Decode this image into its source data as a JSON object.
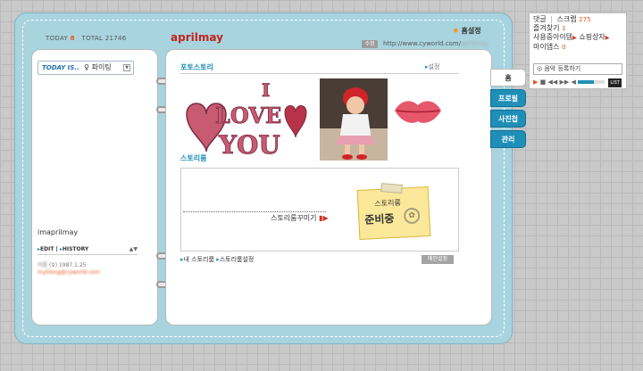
{
  "header": {
    "today_label": "TODAY",
    "today_value": "8",
    "total_label": "TOTAL",
    "total_value": "21746",
    "title": "aprilmay",
    "home_settings": "홈설정",
    "edit_button": "수정",
    "url_visible": "http://www.cyworld.com/",
    "url_hidden": "aprilmay"
  },
  "left_page": {
    "today_is_label": "TODAY IS..",
    "today_mood": "파이팅",
    "owner_name": "imaprilmay",
    "edit_label": "EDIT",
    "history_label": "HISTORY",
    "profile_line1_blurred": "이름",
    "profile_line1": "(♀) 1987.1.25",
    "profile_line2_blurred": "mylilong@cyworld.com"
  },
  "photo_section": {
    "title": "포토스토리",
    "settings": "설정",
    "love_text": [
      "I",
      "LOVE",
      "YOU"
    ]
  },
  "story_section": {
    "title": "스토리룸",
    "decorate_link": "스토리룸꾸미기",
    "note_line1": "스토리룸",
    "note_line2": "준비중",
    "my_storyroom": "내 스토리룸",
    "storyroom_settings": "스토리룸설정",
    "main_settings": "메인설정"
  },
  "tabs": [
    {
      "label": "홈"
    },
    {
      "label": "프로필"
    },
    {
      "label": "사진첩"
    },
    {
      "label": "관리"
    }
  ],
  "notify": {
    "comments": "댓글",
    "scrap": "스크랩",
    "scrap_count": "275",
    "favorites": "즐겨찾기",
    "favorites_count": "1",
    "items": "사용중아이템",
    "shop": "쇼핑상자",
    "my_apps": "마이앱스",
    "my_apps_count": "0",
    "music_placeholder": "음악 등록하기",
    "list_label": "LIST"
  },
  "colors": {
    "frame": "#a8d4df",
    "accent": "#1f8fb8",
    "title": "#c0241c",
    "count": "#e4541c"
  }
}
